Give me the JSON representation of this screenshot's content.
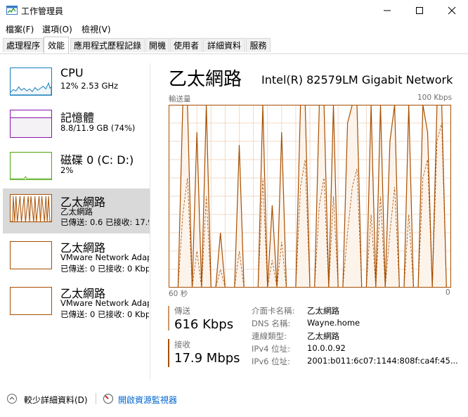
{
  "window": {
    "title": "工作管理員"
  },
  "menu": [
    "檔案(F)",
    "選項(O)",
    "檢視(V)"
  ],
  "tabs": [
    "處理程序",
    "效能",
    "應用程式歷程記錄",
    "開機",
    "使用者",
    "詳細資料",
    "服務"
  ],
  "active_tab": "效能",
  "sidebar": {
    "items": [
      {
        "title": "CPU",
        "sub1": "12%  2.53 GHz",
        "sub2": "",
        "sub3": ""
      },
      {
        "title": "記憶體",
        "sub1": "8.8/11.9 GB (74%)",
        "sub2": "",
        "sub3": ""
      },
      {
        "title": "磁碟 0 (C: D:)",
        "sub1": "2%",
        "sub2": "",
        "sub3": ""
      },
      {
        "title": "乙太網路",
        "sub1": "乙太網路",
        "sub2": "已傳送: 0.6  已接收: 17.9",
        "sub3": ""
      },
      {
        "title": "乙太網路",
        "sub1": "VMware Network Adap",
        "sub2": "已傳送: 0  已接收: 0 Kbp",
        "sub3": ""
      },
      {
        "title": "乙太網路",
        "sub1": "VMware Network Adap",
        "sub2": "已傳送: 0  已接收: 0 Kbp",
        "sub3": ""
      }
    ]
  },
  "main": {
    "title": "乙太網路",
    "adapter": "Intel(R) 82579LM Gigabit Network ...",
    "graph": {
      "y_label": "輸送量",
      "y_max_label": "100 Kbps",
      "x_left": "60 秒",
      "x_right": "0"
    },
    "send_label": "傳送",
    "send_value": "616 Kbps",
    "recv_label": "接收",
    "recv_value": "17.9 Mbps",
    "info": [
      {
        "key": "介面卡名稱:",
        "value": "乙太網路"
      },
      {
        "key": "DNS 名稱:",
        "value": "Wayne.home"
      },
      {
        "key": "連線類型:",
        "value": "乙太網路"
      },
      {
        "key": "IPv4 位址:",
        "value": "10.0.0.92"
      },
      {
        "key": "IPv6 位址:",
        "value": "2001:b011:6c07:1144:808f:ca4f:45..."
      }
    ]
  },
  "footer": {
    "fewer_details": "較少詳細資料(D)",
    "open_monitor": "開啟資源監視器"
  },
  "colors": {
    "ethernet": "#a74f01",
    "cpu": "#117dbb",
    "memory": "#8b12ae",
    "disk": "#4da60c",
    "graph_fill": "#fcf3eb"
  },
  "chart_data": {
    "type": "area",
    "x_label": "60 秒",
    "y_max": 100,
    "y_unit": "Kbps",
    "series": [
      {
        "values": [
          0,
          0,
          0,
          100,
          100,
          0,
          85,
          0,
          100,
          0,
          0,
          30,
          0,
          0,
          0,
          78,
          0,
          0,
          0,
          0,
          100,
          0,
          45,
          0,
          85,
          0,
          0,
          0,
          100,
          100,
          0,
          0,
          100,
          100,
          0,
          100,
          0,
          0,
          90,
          100,
          100,
          0,
          0,
          100,
          0,
          100,
          0,
          80,
          100,
          0,
          0,
          100,
          0,
          0,
          100,
          85,
          0,
          100,
          100,
          0,
          0
        ]
      },
      {
        "values": [
          0,
          0,
          0,
          40,
          60,
          0,
          20,
          0,
          50,
          0,
          0,
          10,
          0,
          0,
          0,
          20,
          0,
          0,
          0,
          0,
          60,
          0,
          15,
          0,
          25,
          0,
          0,
          0,
          55,
          70,
          0,
          0,
          45,
          60,
          0,
          50,
          0,
          0,
          30,
          55,
          65,
          0,
          0,
          40,
          0,
          50,
          0,
          30,
          55,
          0,
          0,
          40,
          0,
          0,
          60,
          70,
          0,
          80,
          90,
          0,
          0
        ]
      }
    ]
  }
}
